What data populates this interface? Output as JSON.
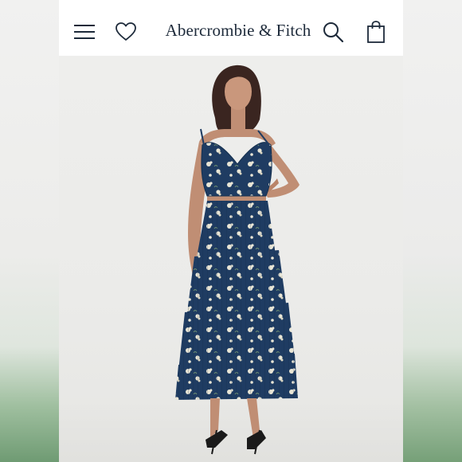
{
  "header": {
    "brand": "Abercrombie & Fitch",
    "icons": [
      "menu-icon",
      "heart-icon",
      "search-icon",
      "shopping-bag-icon"
    ]
  },
  "product_image": {
    "description_icon": "model-photo"
  },
  "colors": {
    "brand_text": "#1d2a3a",
    "dress_navy": "#1f3c62",
    "floral": "#e9e6d6"
  }
}
